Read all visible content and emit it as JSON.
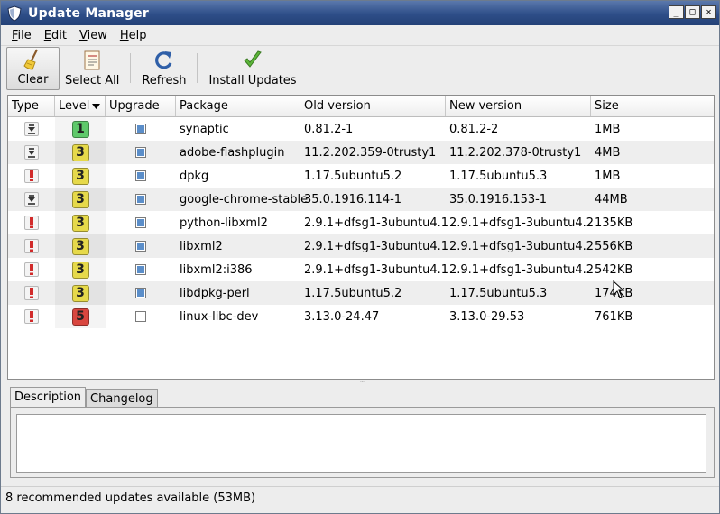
{
  "window": {
    "title": "Update Manager"
  },
  "menu": [
    {
      "label": "File",
      "mnemonic": "F",
      "rest": "ile"
    },
    {
      "label": "Edit",
      "mnemonic": "E",
      "rest": "dit"
    },
    {
      "label": "View",
      "mnemonic": "V",
      "rest": "iew"
    },
    {
      "label": "Help",
      "mnemonic": "H",
      "rest": "elp"
    }
  ],
  "toolbar": {
    "clear": "Clear",
    "select_all": "Select All",
    "refresh": "Refresh",
    "install": "Install Updates"
  },
  "columns": {
    "type": "Type",
    "level": "Level",
    "upgrade": "Upgrade",
    "package": "Package",
    "old_version": "Old version",
    "new_version": "New version",
    "size": "Size"
  },
  "level_colors": {
    "1": "#5fc96b",
    "3": "#e6d94a",
    "5": "#d9463f"
  },
  "rows": [
    {
      "type": "package-icon",
      "level": "1",
      "upgrade": true,
      "package": "synaptic",
      "old": "0.81.2-1",
      "new": "0.81.2-2",
      "size": "1MB"
    },
    {
      "type": "package-icon",
      "level": "3",
      "upgrade": true,
      "package": "adobe-flashplugin",
      "old": "11.2.202.359-0trusty1",
      "new": "11.2.202.378-0trusty1",
      "size": "4MB"
    },
    {
      "type": "security-icon",
      "level": "3",
      "upgrade": true,
      "package": "dpkg",
      "old": "1.17.5ubuntu5.2",
      "new": "1.17.5ubuntu5.3",
      "size": "1MB"
    },
    {
      "type": "package-icon",
      "level": "3",
      "upgrade": true,
      "package": "google-chrome-stable",
      "old": "35.0.1916.114-1",
      "new": "35.0.1916.153-1",
      "size": "44MB"
    },
    {
      "type": "security-icon",
      "level": "3",
      "upgrade": true,
      "package": "python-libxml2",
      "old": "2.9.1+dfsg1-3ubuntu4.1",
      "new": "2.9.1+dfsg1-3ubuntu4.2",
      "size": "135KB"
    },
    {
      "type": "security-icon",
      "level": "3",
      "upgrade": true,
      "package": "libxml2",
      "old": "2.9.1+dfsg1-3ubuntu4.1",
      "new": "2.9.1+dfsg1-3ubuntu4.2",
      "size": "556KB"
    },
    {
      "type": "security-icon",
      "level": "3",
      "upgrade": true,
      "package": "libxml2:i386",
      "old": "2.9.1+dfsg1-3ubuntu4.1",
      "new": "2.9.1+dfsg1-3ubuntu4.2",
      "size": "542KB"
    },
    {
      "type": "security-icon",
      "level": "3",
      "upgrade": true,
      "package": "libdpkg-perl",
      "old": "1.17.5ubuntu5.2",
      "new": "1.17.5ubuntu5.3",
      "size": "174KB"
    },
    {
      "type": "security-icon",
      "level": "5",
      "upgrade": false,
      "package": "linux-libc-dev",
      "old": "3.13.0-24.47",
      "new": "3.13.0-29.53",
      "size": "761KB"
    }
  ],
  "tabs": [
    "Description",
    "Changelog"
  ],
  "status": "8 recommended updates available (53MB)"
}
